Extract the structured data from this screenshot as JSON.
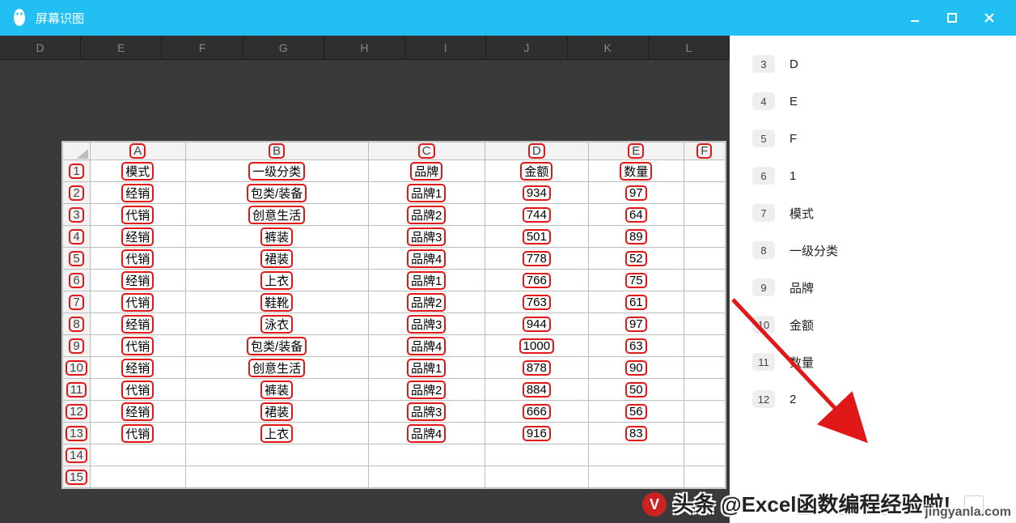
{
  "titlebar": {
    "title": "屏幕识图"
  },
  "bg_cols": [
    "D",
    "E",
    "F",
    "G",
    "H",
    "I",
    "J",
    "K",
    "L"
  ],
  "sheet": {
    "cols": [
      "A",
      "B",
      "C",
      "D",
      "E",
      "F"
    ],
    "rows": [
      {
        "n": "1",
        "cells": [
          "模式",
          "一级分类",
          "品牌",
          "金额",
          "数量",
          ""
        ]
      },
      {
        "n": "2",
        "cells": [
          "经销",
          "包类/装备",
          "品牌1",
          "934",
          "97",
          ""
        ]
      },
      {
        "n": "3",
        "cells": [
          "代销",
          "创意生活",
          "品牌2",
          "744",
          "64",
          ""
        ]
      },
      {
        "n": "4",
        "cells": [
          "经销",
          "裤装",
          "品牌3",
          "501",
          "89",
          ""
        ]
      },
      {
        "n": "5",
        "cells": [
          "代销",
          "裙装",
          "品牌4",
          "778",
          "52",
          ""
        ]
      },
      {
        "n": "6",
        "cells": [
          "经销",
          "上衣",
          "品牌1",
          "766",
          "75",
          ""
        ]
      },
      {
        "n": "7",
        "cells": [
          "代销",
          "鞋靴",
          "品牌2",
          "763",
          "61",
          ""
        ]
      },
      {
        "n": "8",
        "cells": [
          "经销",
          "泳衣",
          "品牌3",
          "944",
          "97",
          ""
        ]
      },
      {
        "n": "9",
        "cells": [
          "代销",
          "包类/装备",
          "品牌4",
          "1000",
          "63",
          ""
        ]
      },
      {
        "n": "10",
        "cells": [
          "经销",
          "创意生活",
          "品牌1",
          "878",
          "90",
          ""
        ]
      },
      {
        "n": "11",
        "cells": [
          "代销",
          "裤装",
          "品牌2",
          "884",
          "50",
          ""
        ]
      },
      {
        "n": "12",
        "cells": [
          "经销",
          "裙装",
          "品牌3",
          "666",
          "56",
          ""
        ]
      },
      {
        "n": "13",
        "cells": [
          "代销",
          "上衣",
          "品牌4",
          "916",
          "83",
          ""
        ]
      },
      {
        "n": "14",
        "cells": [
          "",
          "",
          "",
          "",
          "",
          ""
        ]
      },
      {
        "n": "15",
        "cells": [
          "",
          "",
          "",
          "",
          "",
          ""
        ]
      }
    ]
  },
  "sidebar_items": [
    {
      "num": "3",
      "label": "D"
    },
    {
      "num": "4",
      "label": "E"
    },
    {
      "num": "5",
      "label": "F"
    },
    {
      "num": "6",
      "label": "1"
    },
    {
      "num": "7",
      "label": "模式"
    },
    {
      "num": "8",
      "label": "一级分类"
    },
    {
      "num": "9",
      "label": "品牌"
    },
    {
      "num": "10",
      "label": "金额"
    },
    {
      "num": "11",
      "label": "数量"
    },
    {
      "num": "12",
      "label": "2"
    }
  ],
  "watermark": {
    "text": "头条 @Excel函数编程经验啦!",
    "site": "jingyanla.com",
    "avatar": "V"
  }
}
